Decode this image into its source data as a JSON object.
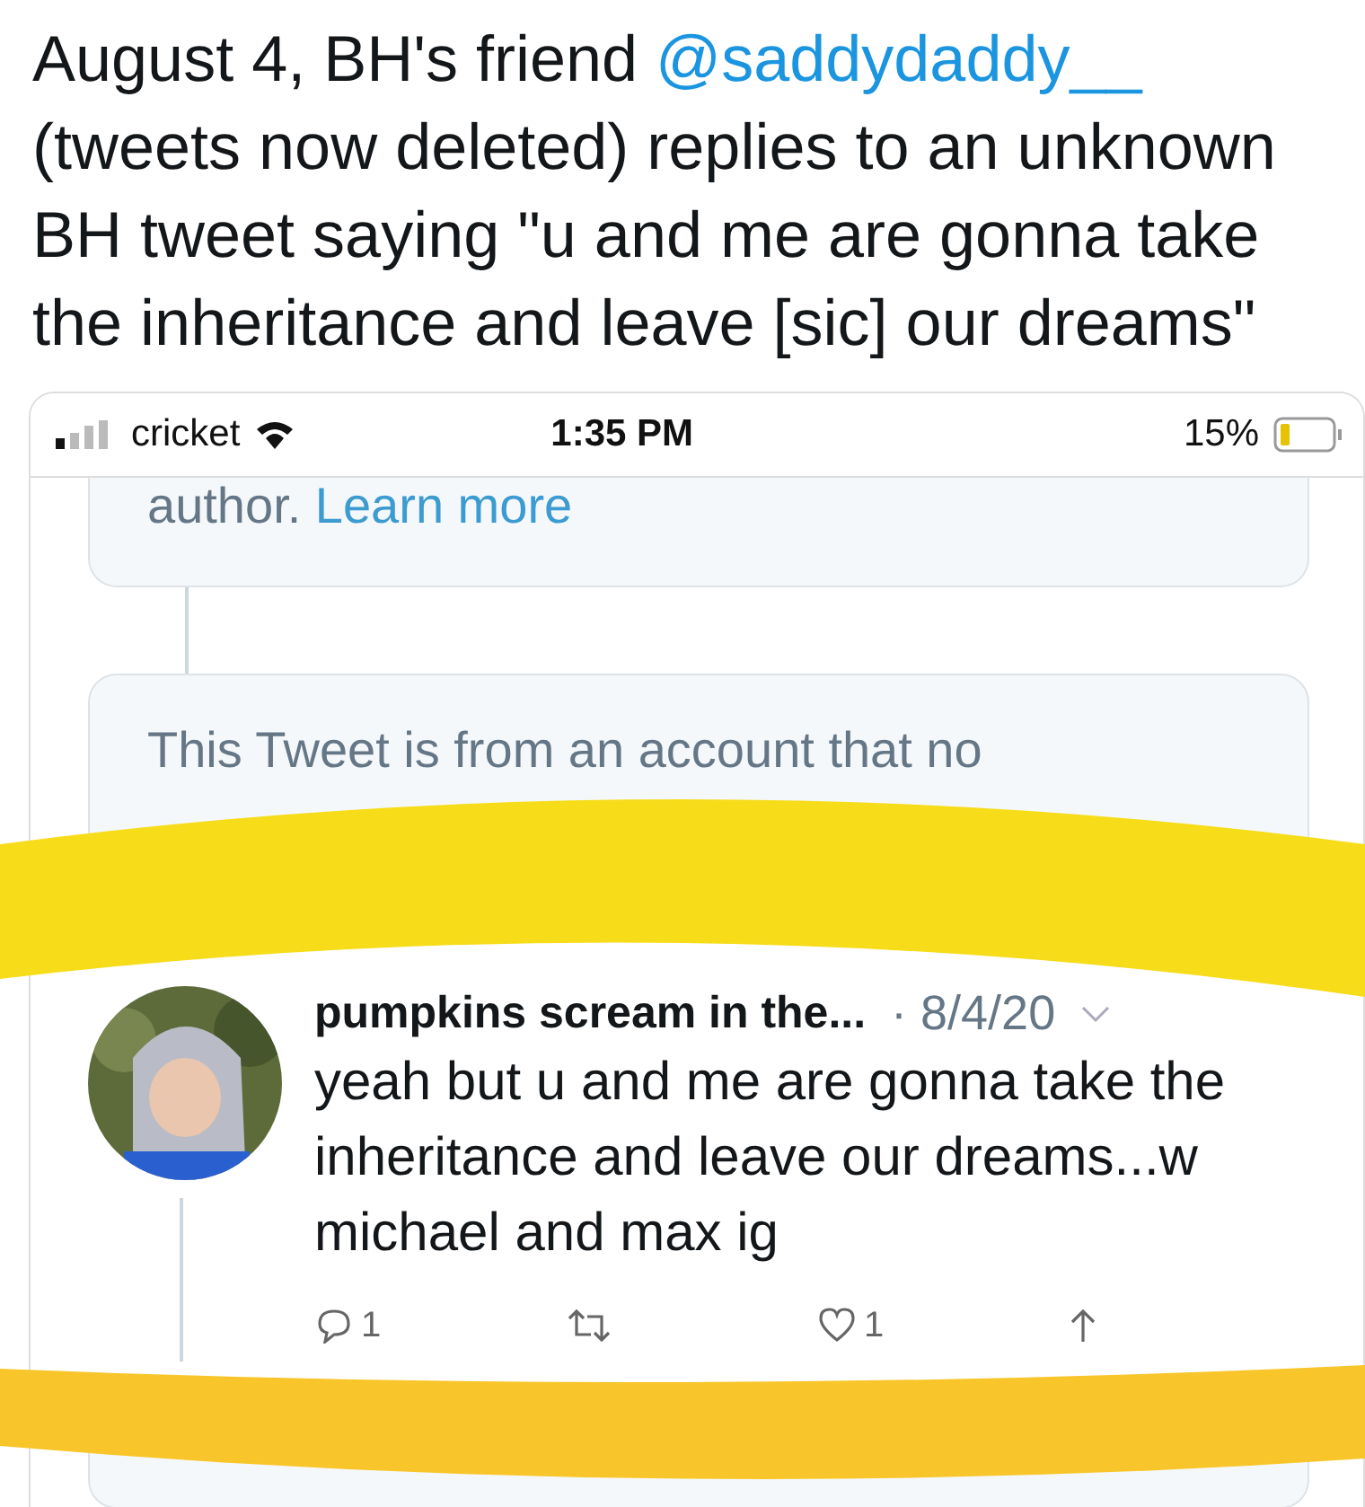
{
  "caption": {
    "before": "August 4, BH's friend ",
    "link": "@saddydaddy__",
    "after": " (tweets now deleted) replies to an unknown BH tweet saying \"u and me are gonna take the inheritance and leave [sic] our dreams\""
  },
  "status_bar": {
    "carrier": "cricket",
    "time": "1:35 PM",
    "battery": "15%"
  },
  "notice_1": {
    "text": "author.",
    "link": "Learn more"
  },
  "notice_2": {
    "text": "This Tweet is from an account that no"
  },
  "tweet": {
    "name": "pumpkins scream in the...",
    "date": "· 8/4/20",
    "body": "yeah but u and me are gonna take the inheritance and leave our dreams...w michael and max ig",
    "actions": [
      {
        "kind": "reply",
        "count": "1"
      },
      {
        "kind": "retweet"
      },
      {
        "kind": "like",
        "count": "1"
      },
      {
        "kind": "share"
      }
    ]
  }
}
